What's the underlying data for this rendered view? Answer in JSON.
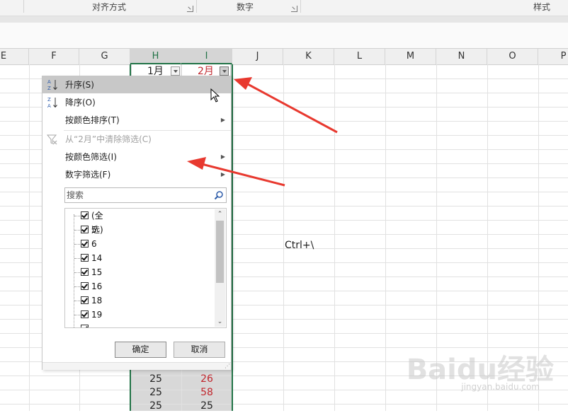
{
  "ribbon": {
    "groups": [
      "对齐方式",
      "数字",
      "样式"
    ]
  },
  "columns": [
    "E",
    "F",
    "G",
    "H",
    "I",
    "J",
    "K",
    "L",
    "M",
    "N",
    "O",
    "P"
  ],
  "header_cells": {
    "h": "1月",
    "i": "2月"
  },
  "sheet": {
    "ctrl_note": "Ctrl+\\",
    "bottom_rows": [
      {
        "h": "25",
        "i": "26",
        "i_red": true
      },
      {
        "h": "25",
        "i": "58",
        "i_red": true
      },
      {
        "h": "25",
        "i": "25",
        "i_red": false
      }
    ]
  },
  "filter_menu": {
    "sort_asc": "升序(S)",
    "sort_desc": "降序(O)",
    "sort_by_color": "按颜色排序(T)",
    "clear_filter": "从“2月”中清除筛选(C)",
    "filter_by_color": "按颜色筛选(I)",
    "number_filter": "数字筛选(F)",
    "search_placeholder": "搜索",
    "list_items": [
      "(全选)",
      "5",
      "6",
      "14",
      "15",
      "16",
      "18",
      "19"
    ],
    "ok_label": "确定",
    "cancel_label": "取消"
  },
  "watermark": {
    "brand": "Baidu经验",
    "url": "jingyan.baidu.com"
  },
  "colors": {
    "accent_green": "#217346",
    "arrow_red": "#e8392f",
    "value_red": "#c0262d"
  }
}
